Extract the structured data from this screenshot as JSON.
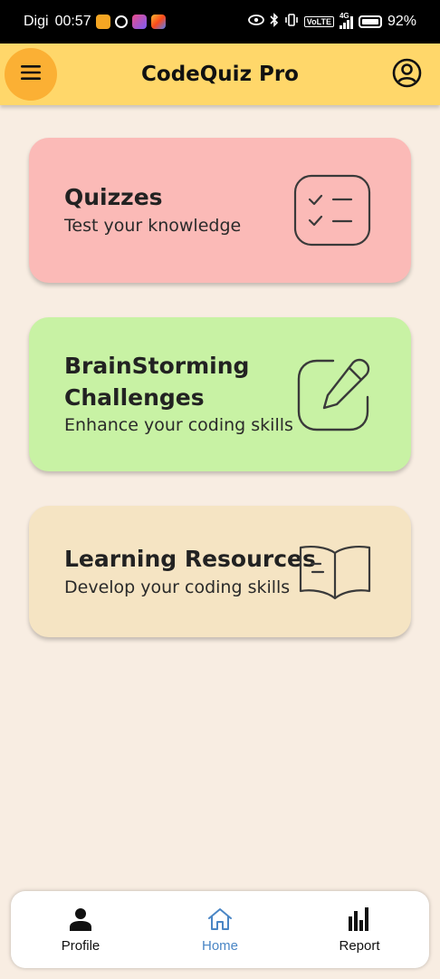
{
  "status_bar": {
    "carrier": "Digi",
    "time": "00:57",
    "battery": "92%",
    "volte": "VoLTE",
    "network": "4G"
  },
  "app_bar": {
    "title": "CodeQuiz Pro",
    "menu_icon": "hamburger-menu-icon",
    "profile_icon": "account-circle-icon",
    "color": "#ffd76a",
    "menu_button_color": "#fbb034"
  },
  "cards": [
    {
      "title": "Quizzes",
      "subtitle": "Test your knowledge",
      "icon": "checklist-icon",
      "color": "#fbbab7"
    },
    {
      "title_line1": "BrainStorming",
      "title_line2": "Challenges",
      "subtitle": "Enhance your coding skills",
      "icon": "edit-pencil-icon",
      "color": "#c8f2a4"
    },
    {
      "title": "Learning Resources",
      "subtitle": "Develop your coding skills",
      "icon": "open-book-icon",
      "color": "#f5e4c3"
    }
  ],
  "bottom_nav": {
    "items": [
      {
        "label": "Profile",
        "icon": "person-icon",
        "active": false
      },
      {
        "label": "Home",
        "icon": "home-icon",
        "active": true
      },
      {
        "label": "Report",
        "icon": "bar-chart-icon",
        "active": false
      }
    ],
    "active_color": "#4a86c5"
  },
  "background_color": "#f8ede2"
}
